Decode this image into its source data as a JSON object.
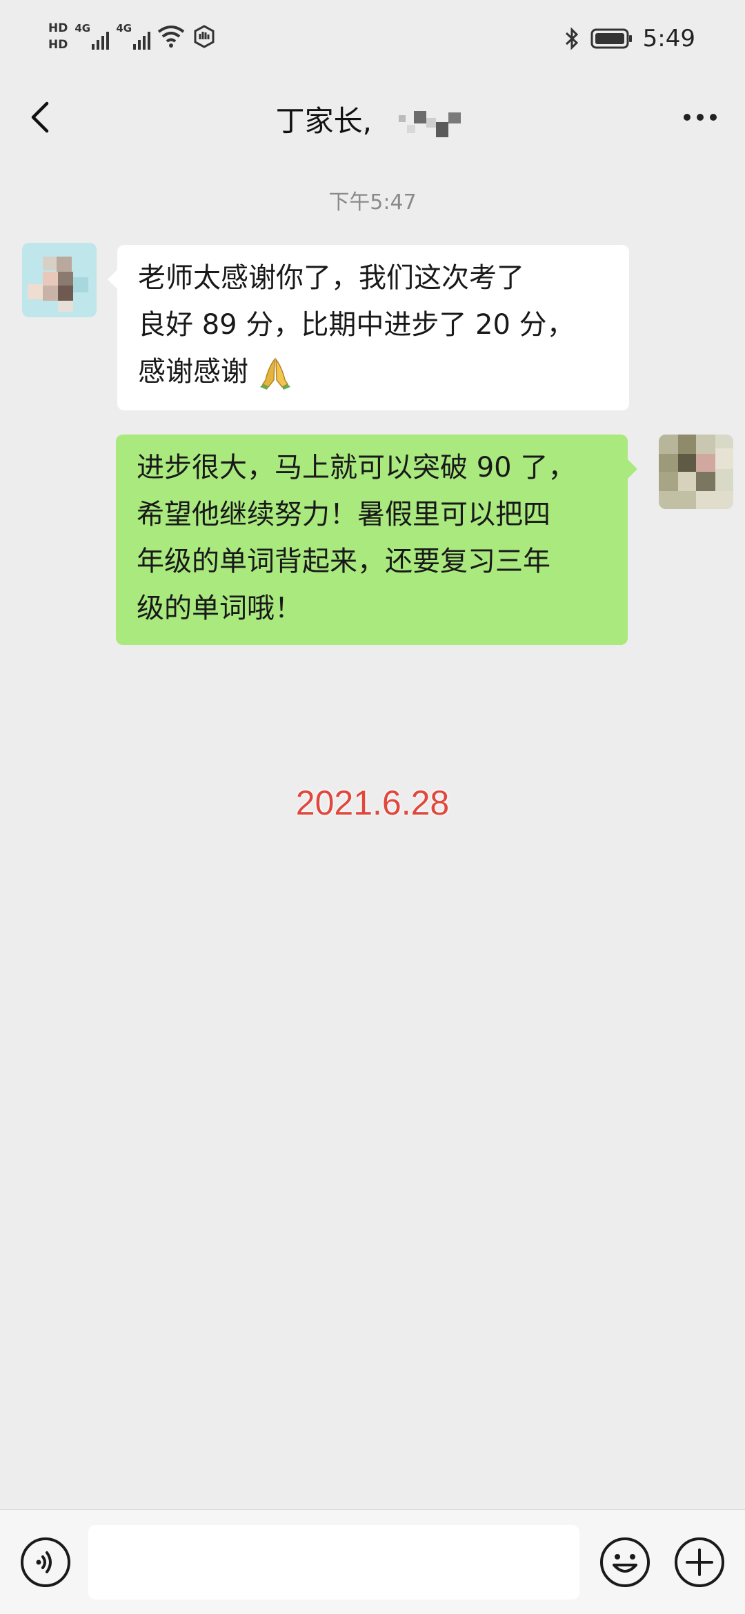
{
  "status_bar": {
    "sim1_label": "HD",
    "sim2_label": "HD",
    "network1_label": "4G",
    "network2_label": "4G",
    "time": "5:49",
    "icons": [
      "wifi-icon",
      "hotspot-icon",
      "bluetooth-icon",
      "battery-icon"
    ]
  },
  "header": {
    "title": "丁家长,",
    "back_icon": "chevron-left-icon",
    "more_icon": "more-dots-icon"
  },
  "conversation": {
    "timestamp": "下午5:47",
    "messages": [
      {
        "side": "left",
        "lines": [
          "老师太感谢你了，我们这次考了",
          "良好 89 分，比期中进步了 20 分，",
          "感谢感谢"
        ],
        "emoji": "folded-hands-icon",
        "bubble_color": "#ffffff"
      },
      {
        "side": "right",
        "lines": [
          "进步很大，马上就可以突破 90 了，",
          "希望他继续努力！暑假里可以把四",
          "年级的单词背起来，还要复习三年",
          "级的单词哦！"
        ],
        "bubble_color": "#a9e97e"
      }
    ]
  },
  "overlay": {
    "date": "2021.6.28",
    "color": "#e0473d"
  },
  "input_bar": {
    "voice_icon": "voice-icon",
    "text_value": "",
    "emoji_icon": "emoji-icon",
    "plus_icon": "plus-circle-icon"
  }
}
